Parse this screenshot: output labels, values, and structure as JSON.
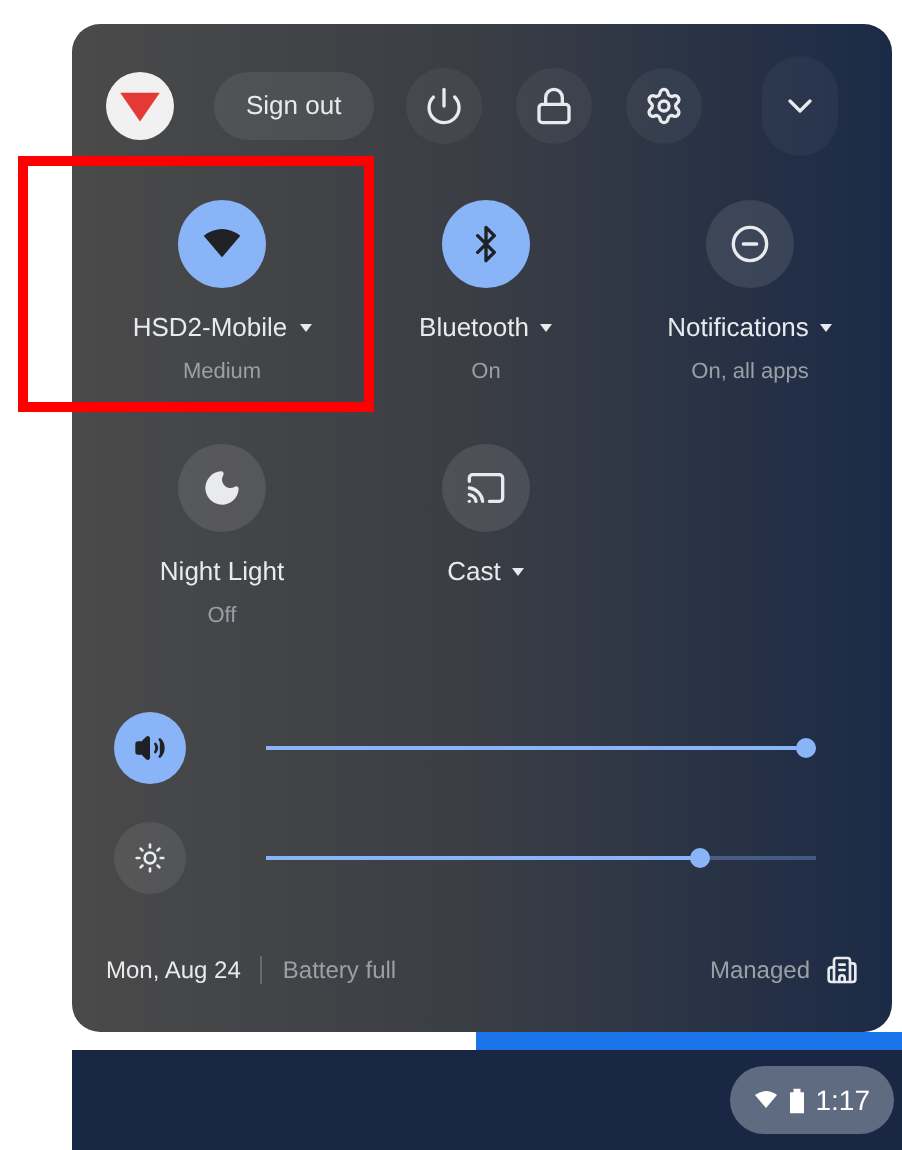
{
  "header": {
    "sign_out": "Sign out"
  },
  "tiles": [
    {
      "kind": "wifi",
      "label": "HSD2-Mobile",
      "sublabel": "Medium",
      "dropdown": true,
      "on": true,
      "highlighted": true
    },
    {
      "kind": "bluetooth",
      "label": "Bluetooth",
      "sublabel": "On",
      "dropdown": true,
      "on": true,
      "highlighted": false
    },
    {
      "kind": "notifications",
      "label": "Notifications",
      "sublabel": "On, all apps",
      "dropdown": true,
      "on": false,
      "highlighted": false
    },
    {
      "kind": "night-light",
      "label": "Night Light",
      "sublabel": "Off",
      "dropdown": false,
      "on": false,
      "highlighted": false
    },
    {
      "kind": "cast",
      "label": "Cast",
      "dropdown": true,
      "on": false,
      "highlighted": false
    }
  ],
  "sliders": [
    {
      "kind": "volume",
      "on": true,
      "level": 0.98
    },
    {
      "kind": "brightness",
      "on": false,
      "level": 0.79
    }
  ],
  "footer": {
    "date": "Mon, Aug 24",
    "battery": "Battery full",
    "managed": "Managed"
  },
  "shelf": {
    "time": "1:17"
  }
}
